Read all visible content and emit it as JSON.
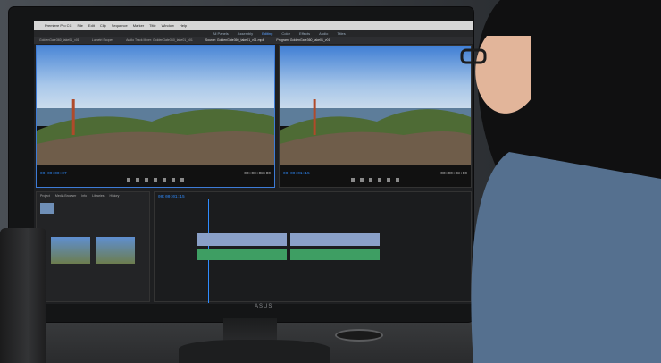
{
  "app": {
    "name": "Premiere Pro CC",
    "menu": [
      "Premiere Pro CC",
      "File",
      "Edit",
      "Clip",
      "Sequence",
      "Marker",
      "Title",
      "Window",
      "Help"
    ]
  },
  "workspaces": [
    "All Panels",
    "Assembly",
    "Editing",
    "Color",
    "Effects",
    "Audio",
    "Titles"
  ],
  "panels": {
    "tabs": [
      "GoldenGate360_take01_v01",
      "Lumetri Scopes",
      "Audio Track Mixer: GoldenGate360_take01_v01",
      "Source: GoldenGate360_take01_v01.mp4",
      "Program: GoldenGate360_take01_v01"
    ],
    "source_timecode": "00:00:00:07",
    "source_duration": "00:00:08:00",
    "program_timecode": "00:00:01:15",
    "program_duration": "00:00:08:00",
    "timeline_timecode": "00:00:01:15",
    "project_tabs": [
      "Project",
      "Media Browser",
      "Info",
      "Libraries",
      "History"
    ],
    "brand": "ASUS"
  },
  "colors": {
    "accent": "#2f8cff",
    "video_clip": "#8aa0c8",
    "audio_clip": "#3e9e63"
  }
}
